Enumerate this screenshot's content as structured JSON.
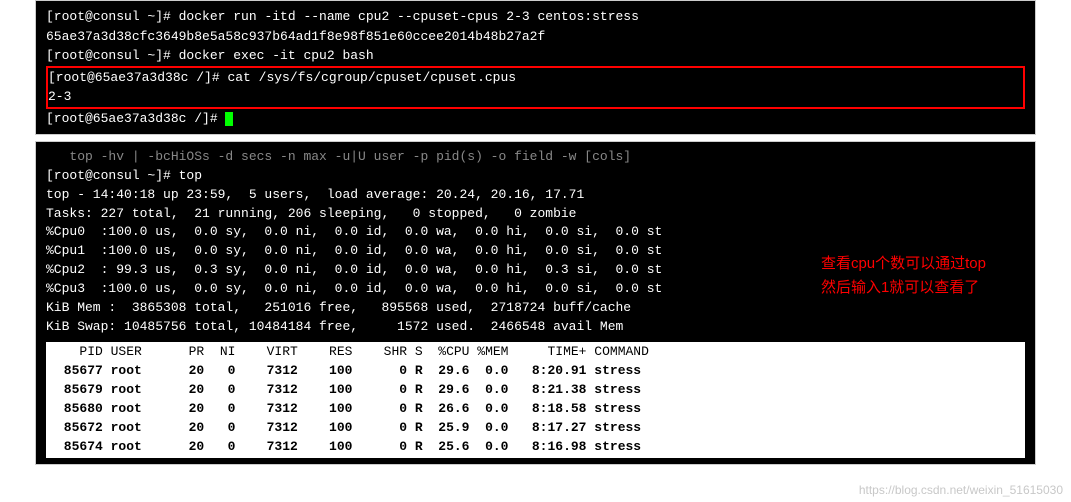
{
  "term1": {
    "line1_prompt": "[root@consul ~]# ",
    "line1_cmd": "docker run -itd --name cpu2 --cpuset-cpus 2-3 centos:stress",
    "line2": "65ae37a3d38cfc3649b8e5a58c937b64ad1f8e98f851e60ccee2014b48b27a2f",
    "line3_prompt": "[root@consul ~]# ",
    "line3_cmd": "docker exec -it cpu2 bash",
    "box_line1_prompt": "[root@65ae37a3d38c /]# ",
    "box_line1_cmd": "cat /sys/fs/cgroup/cpuset/cpuset.cpus",
    "box_line2": "2-3",
    "line6_prompt": "[root@65ae37a3d38c /]# "
  },
  "term2": {
    "cut_line": "   top -hv | -bcHiOSs -d secs -n max -u|U user -p pid(s) -o field -w [cols]",
    "prompt_line": "[root@consul ~]# top",
    "top_summary": {
      "l1": "top - 14:40:18 up 23:59,  5 users,  load average: 20.24, 20.16, 17.71",
      "l2": "Tasks: 227 total,  21 running, 206 sleeping,   0 stopped,   0 zombie",
      "l3": "%Cpu0  :100.0 us,  0.0 sy,  0.0 ni,  0.0 id,  0.0 wa,  0.0 hi,  0.0 si,  0.0 st",
      "l4": "%Cpu1  :100.0 us,  0.0 sy,  0.0 ni,  0.0 id,  0.0 wa,  0.0 hi,  0.0 si,  0.0 st",
      "l5": "%Cpu2  : 99.3 us,  0.3 sy,  0.0 ni,  0.0 id,  0.0 wa,  0.0 hi,  0.3 si,  0.0 st",
      "l6": "%Cpu3  :100.0 us,  0.0 sy,  0.0 ni,  0.0 id,  0.0 wa,  0.0 hi,  0.0 si,  0.0 st",
      "l7": "KiB Mem :  3865308 total,   251016 free,   895568 used,  2718724 buff/cache",
      "l8": "KiB Swap: 10485756 total, 10484184 free,     1572 used.  2466548 avail Mem"
    },
    "table": {
      "header": "   PID USER      PR  NI    VIRT    RES    SHR S  %CPU %MEM     TIME+ COMMAND",
      "rows": [
        " 85677 root      20   0    7312    100      0 R  29.6  0.0   8:20.91 stress",
        " 85679 root      20   0    7312    100      0 R  29.6  0.0   8:21.38 stress",
        " 85680 root      20   0    7312    100      0 R  26.6  0.0   8:18.58 stress",
        " 85672 root      20   0    7312    100      0 R  25.9  0.0   8:17.27 stress",
        " 85674 root      20   0    7312    100      0 R  25.6  0.0   8:16.98 stress"
      ]
    }
  },
  "annotation": {
    "line1": "查看cpu个数可以通过top",
    "line2": "然后输入1就可以查看了"
  },
  "watermark": "https://blog.csdn.net/weixin_51615030",
  "chart_data": {
    "type": "table",
    "title": "top process list",
    "columns": [
      "PID",
      "USER",
      "PR",
      "NI",
      "VIRT",
      "RES",
      "SHR",
      "S",
      "%CPU",
      "%MEM",
      "TIME+",
      "COMMAND"
    ],
    "rows": [
      [
        85677,
        "root",
        20,
        0,
        7312,
        100,
        0,
        "R",
        29.6,
        0.0,
        "8:20.91",
        "stress"
      ],
      [
        85679,
        "root",
        20,
        0,
        7312,
        100,
        0,
        "R",
        29.6,
        0.0,
        "8:21.38",
        "stress"
      ],
      [
        85680,
        "root",
        20,
        0,
        7312,
        100,
        0,
        "R",
        26.6,
        0.0,
        "8:18.58",
        "stress"
      ],
      [
        85672,
        "root",
        20,
        0,
        7312,
        100,
        0,
        "R",
        25.9,
        0.0,
        "8:17.27",
        "stress"
      ],
      [
        85674,
        "root",
        20,
        0,
        7312,
        100,
        0,
        "R",
        25.6,
        0.0,
        "8:16.98",
        "stress"
      ]
    ],
    "cpu_summary": {
      "Cpu0": {
        "us": 100.0,
        "sy": 0.0,
        "ni": 0.0,
        "id": 0.0,
        "wa": 0.0,
        "hi": 0.0,
        "si": 0.0,
        "st": 0.0
      },
      "Cpu1": {
        "us": 100.0,
        "sy": 0.0,
        "ni": 0.0,
        "id": 0.0,
        "wa": 0.0,
        "hi": 0.0,
        "si": 0.0,
        "st": 0.0
      },
      "Cpu2": {
        "us": 99.3,
        "sy": 0.3,
        "ni": 0.0,
        "id": 0.0,
        "wa": 0.0,
        "hi": 0.0,
        "si": 0.3,
        "st": 0.0
      },
      "Cpu3": {
        "us": 100.0,
        "sy": 0.0,
        "ni": 0.0,
        "id": 0.0,
        "wa": 0.0,
        "hi": 0.0,
        "si": 0.0,
        "st": 0.0
      }
    },
    "load_average": [
      20.24,
      20.16,
      17.71
    ],
    "tasks": {
      "total": 227,
      "running": 21,
      "sleeping": 206,
      "stopped": 0,
      "zombie": 0
    },
    "mem_kib": {
      "total": 3865308,
      "free": 251016,
      "used": 895568,
      "buff_cache": 2718724
    },
    "swap_kib": {
      "total": 10485756,
      "free": 10484184,
      "used": 1572,
      "avail_mem": 2466548
    }
  }
}
